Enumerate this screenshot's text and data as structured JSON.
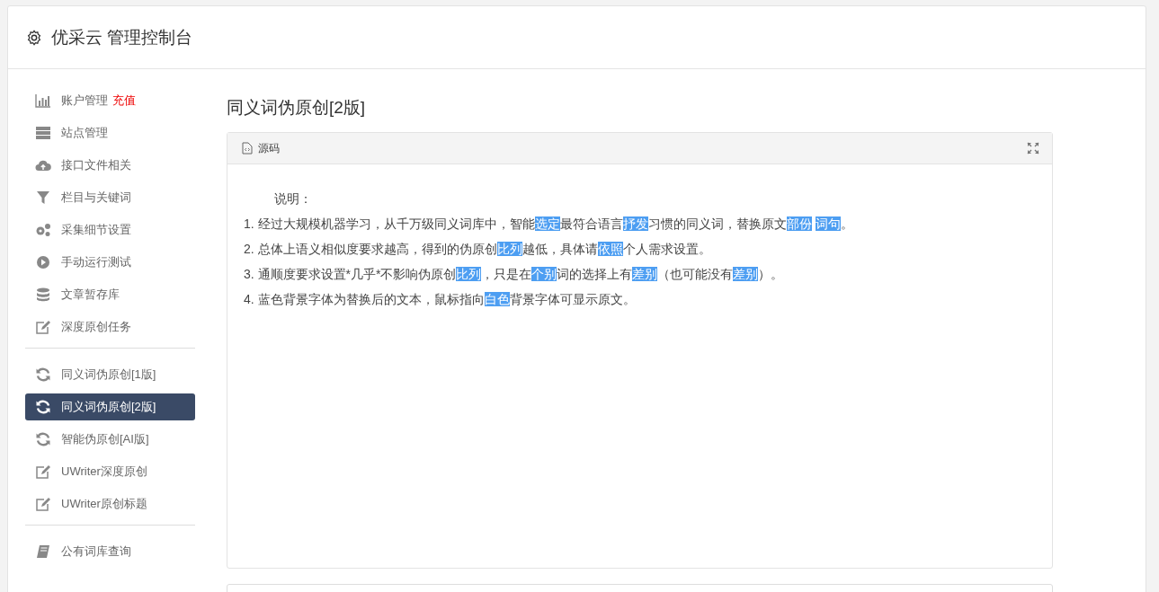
{
  "header": {
    "title": "优采云 管理控制台"
  },
  "sidebar": {
    "groups": [
      {
        "items": [
          {
            "label": "账户管理",
            "badge": "充值",
            "selected": false
          },
          {
            "label": "站点管理",
            "selected": false
          },
          {
            "label": "接口文件相关",
            "selected": false
          },
          {
            "label": "栏目与关键词",
            "selected": false
          },
          {
            "label": "采集细节设置",
            "selected": false
          },
          {
            "label": "手动运行测试",
            "selected": false
          },
          {
            "label": "文章暂存库",
            "selected": false
          },
          {
            "label": "深度原创任务",
            "selected": false
          }
        ]
      },
      {
        "items": [
          {
            "label": "同义词伪原创[1版]",
            "selected": false
          },
          {
            "label": "同义词伪原创[2版]",
            "selected": true
          },
          {
            "label": "智能伪原创[AI版]",
            "selected": false
          },
          {
            "label": "UWriter深度原创",
            "selected": false
          },
          {
            "label": "UWriter原创标题",
            "selected": false
          }
        ]
      },
      {
        "items": [
          {
            "label": "公有词库查询",
            "selected": false
          }
        ]
      }
    ]
  },
  "main": {
    "title": "同义词伪原创[2版]",
    "editor": {
      "tab": "源码",
      "intro": "说明：",
      "lines": [
        [
          {
            "text": "1. 经过大规模机器学习，从千万级同义词库中，智能",
            "highlighted": false
          },
          {
            "text": "选定",
            "highlighted": true
          },
          {
            "text": "最符合语言",
            "highlighted": false
          },
          {
            "text": "抒发",
            "highlighted": true
          },
          {
            "text": "习惯的同义词，替换原文",
            "highlighted": false
          },
          {
            "text": "部份",
            "highlighted": true
          },
          {
            "text": "词句",
            "highlighted": true
          },
          {
            "text": "。",
            "highlighted": false
          }
        ],
        [
          {
            "text": "2. 总体上语义相似度要求越高，得到的伪原创",
            "highlighted": false
          },
          {
            "text": "比列",
            "highlighted": true
          },
          {
            "text": "越低，具体请",
            "highlighted": false
          },
          {
            "text": "依照",
            "highlighted": true
          },
          {
            "text": "个人需求设置。",
            "highlighted": false
          }
        ],
        [
          {
            "text": "3. 通顺度要求设置*几乎*不影响伪原创",
            "highlighted": false
          },
          {
            "text": "比列",
            "highlighted": true
          },
          {
            "text": "，只是在",
            "highlighted": false
          },
          {
            "text": "个别",
            "highlighted": true
          },
          {
            "text": "词的选择上有",
            "highlighted": false
          },
          {
            "text": "差别",
            "highlighted": true
          },
          {
            "text": "（也可能没有",
            "highlighted": false
          },
          {
            "text": "差别",
            "highlighted": true
          },
          {
            "text": "）。",
            "highlighted": false
          }
        ],
        [
          {
            "text": "4. 蓝色背景字体为替换后的文本，鼠标指向",
            "highlighted": false
          },
          {
            "text": "白色",
            "highlighted": true
          },
          {
            "text": "背景字体可显示原文。",
            "highlighted": false
          }
        ]
      ]
    }
  }
}
